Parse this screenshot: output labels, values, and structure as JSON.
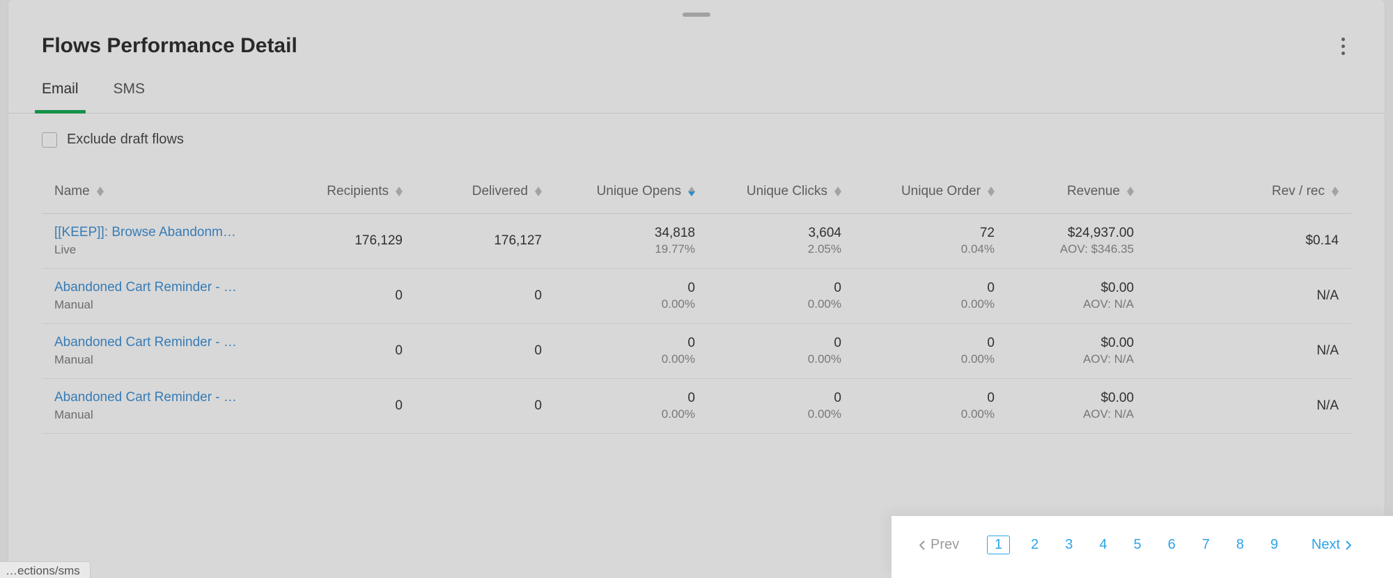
{
  "header": {
    "title": "Flows Performance Detail"
  },
  "tabs": {
    "email": "Email",
    "sms": "SMS"
  },
  "filter": {
    "exclude_label": "Exclude draft flows"
  },
  "columns": {
    "name": "Name",
    "recipients": "Recipients",
    "delivered": "Delivered",
    "unique_opens": "Unique Opens",
    "unique_clicks": "Unique Clicks",
    "unique_order": "Unique Order",
    "revenue": "Revenue",
    "rev_per_rec": "Rev / rec"
  },
  "rows": [
    {
      "name": "[[KEEP]]: Browse Abandonm…",
      "status": "Live",
      "recipients": "176,129",
      "delivered": "176,127",
      "unique_opens": "34,818",
      "unique_opens_pct": "19.77%",
      "unique_clicks": "3,604",
      "unique_clicks_pct": "2.05%",
      "unique_order": "72",
      "unique_order_pct": "0.04%",
      "revenue": "$24,937.00",
      "aov": "AOV: $346.35",
      "rev_per_rec": "$0.14"
    },
    {
      "name": "Abandoned Cart Reminder - …",
      "status": "Manual",
      "recipients": "0",
      "delivered": "0",
      "unique_opens": "0",
      "unique_opens_pct": "0.00%",
      "unique_clicks": "0",
      "unique_clicks_pct": "0.00%",
      "unique_order": "0",
      "unique_order_pct": "0.00%",
      "revenue": "$0.00",
      "aov": "AOV: N/A",
      "rev_per_rec": "N/A"
    },
    {
      "name": "Abandoned Cart Reminder - …",
      "status": "Manual",
      "recipients": "0",
      "delivered": "0",
      "unique_opens": "0",
      "unique_opens_pct": "0.00%",
      "unique_clicks": "0",
      "unique_clicks_pct": "0.00%",
      "unique_order": "0",
      "unique_order_pct": "0.00%",
      "revenue": "$0.00",
      "aov": "AOV: N/A",
      "rev_per_rec": "N/A"
    },
    {
      "name": "Abandoned Cart Reminder - …",
      "status": "Manual",
      "recipients": "0",
      "delivered": "0",
      "unique_opens": "0",
      "unique_opens_pct": "0.00%",
      "unique_clicks": "0",
      "unique_clicks_pct": "0.00%",
      "unique_order": "0",
      "unique_order_pct": "0.00%",
      "revenue": "$0.00",
      "aov": "AOV: N/A",
      "rev_per_rec": "N/A"
    }
  ],
  "pagination": {
    "prev": "Prev",
    "next": "Next",
    "pages": [
      "1",
      "2",
      "3",
      "4",
      "5",
      "6",
      "7",
      "8",
      "9"
    ],
    "active_index": 0
  },
  "status_bar": "…ections/sms"
}
